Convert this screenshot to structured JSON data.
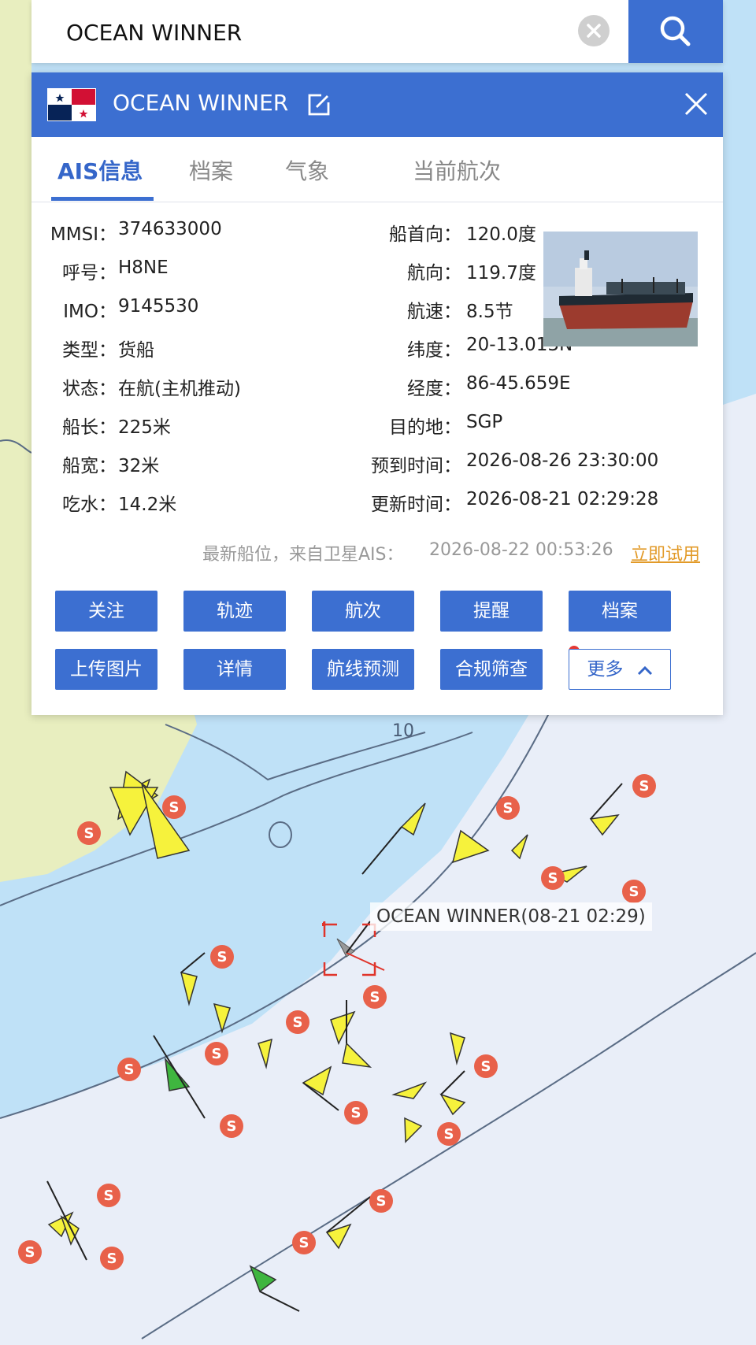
{
  "search": {
    "value": "OCEAN WINNER",
    "placeholder": ""
  },
  "panel": {
    "title": "OCEAN WINNER",
    "tabs": [
      "AIS信息",
      "档案",
      "气象",
      "当前航次"
    ],
    "left_fields": [
      {
        "label": "MMSI：",
        "value": "374633000"
      },
      {
        "label": "呼号：",
        "value": "H8NE"
      },
      {
        "label": "IMO：",
        "value": "9145530"
      },
      {
        "label": "类型：",
        "value": "货船"
      },
      {
        "label": "状态：",
        "value": "在航(主机推动)"
      },
      {
        "label": "船长：",
        "value": "225米"
      },
      {
        "label": "船宽：",
        "value": "32米"
      },
      {
        "label": "吃水：",
        "value": "14.2米"
      }
    ],
    "right_fields": [
      {
        "label": "船首向：",
        "value": "120.0度"
      },
      {
        "label": "航向：",
        "value": "119.7度"
      },
      {
        "label": "航速：",
        "value": "8.5节"
      },
      {
        "label": "纬度：",
        "value": "20-13.013N"
      },
      {
        "label": "经度：",
        "value": "86-45.659E"
      },
      {
        "label": "目的地：",
        "value": "SGP"
      },
      {
        "label": "预到时间：",
        "value": "2026-08-26 23:30:00"
      },
      {
        "label": "更新时间：",
        "value": "2026-08-21 02:29:28"
      }
    ],
    "latest_position_label": "最新船位，来自卫星AIS：",
    "latest_position_time": "2026-08-22 00:53:26",
    "trial_link": "立即试用",
    "buttons_row1": [
      "关注",
      "轨迹",
      "航次",
      "提醒",
      "档案"
    ],
    "buttons_row2": [
      "上传图片",
      "详情",
      "航线预测",
      "合规筛查"
    ],
    "more_button": "更多"
  },
  "map": {
    "selected_label": "OCEAN WINNER(08-21 02:29)",
    "depth_label": "10",
    "marker_badge": "S",
    "colors": {
      "deep_water": "#bfe1f7",
      "shallow_water": "#e9eef8",
      "land": "#e8eebf",
      "vessel": "#f6f23c",
      "vessel_alt": "#3fb63f",
      "badge": "#e8614a"
    }
  },
  "colors": {
    "accent": "#3c6fd1",
    "trial": "#e29a28"
  }
}
